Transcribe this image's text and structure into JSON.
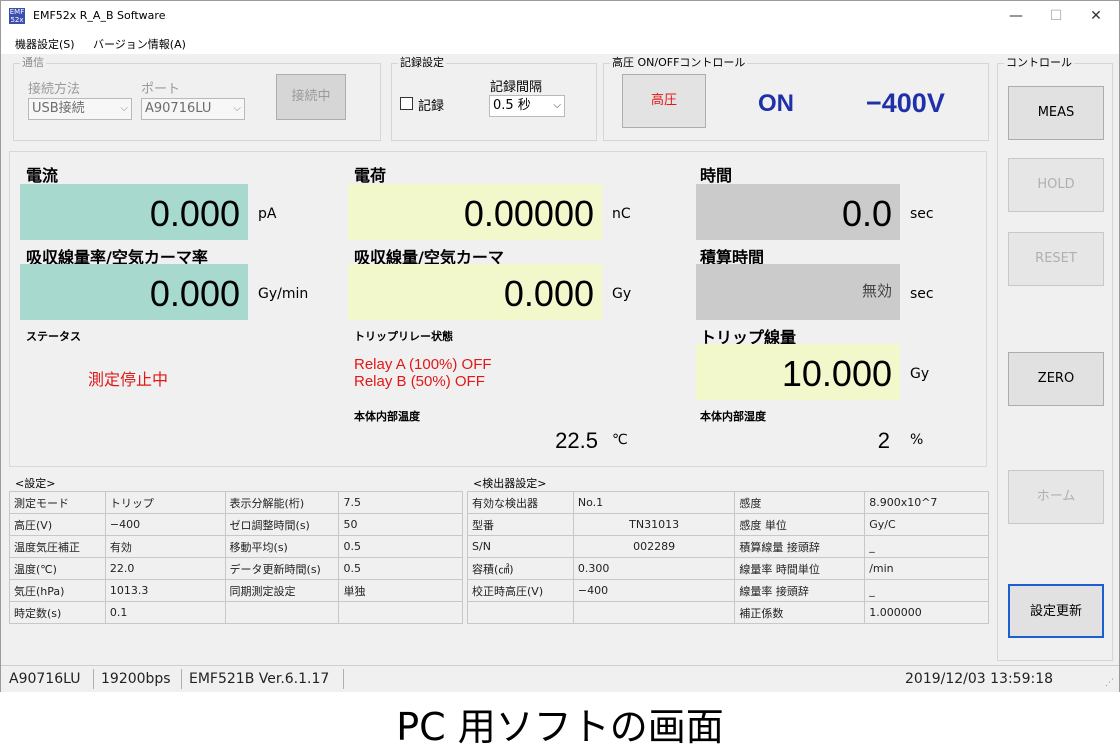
{
  "window": {
    "title": "EMF52x R_A_B Software",
    "icon_text": "EMF\n52x",
    "minimize": "—",
    "maximize": "☐",
    "close": "✕"
  },
  "menu": {
    "items": [
      "機器設定(S)",
      "バージョン情報(A)"
    ]
  },
  "comm": {
    "group_label": "通信",
    "method_label": "接続方法",
    "method_value": "USB接続",
    "port_label": "ポート",
    "port_value": "A90716LU",
    "connect_button": "接続中"
  },
  "record": {
    "group_label": "記録設定",
    "checkbox_label": "記録",
    "interval_label": "記録間隔",
    "interval_value": "0.5 秒"
  },
  "hv": {
    "group_label": "高圧 ON/OFFコントロール",
    "button": "高圧",
    "state": "ON",
    "voltage": "−400V"
  },
  "control": {
    "group_label": "コントロール",
    "meas": "MEAS",
    "hold": "HOLD",
    "reset": "RESET",
    "zero": "ZERO",
    "home": "ホーム",
    "update": "設定更新"
  },
  "display": {
    "current": {
      "label": "電流",
      "value": "0.000",
      "unit": "pA"
    },
    "charge": {
      "label": "電荷",
      "value": "0.00000",
      "unit": "nC"
    },
    "time": {
      "label": "時間",
      "value": "0.0",
      "unit": "sec"
    },
    "doserate": {
      "label": "吸収線量率/空気カーマ率",
      "value": "0.000",
      "unit": "Gy/min"
    },
    "dose": {
      "label": "吸収線量/空気カーマ",
      "value": "0.000",
      "unit": "Gy"
    },
    "integ_time": {
      "label": "積算時間",
      "value": "無効",
      "unit": "sec"
    },
    "status": {
      "label": "ステータス",
      "value": "測定停止中"
    },
    "relay": {
      "label": "トリップリレー状態",
      "line1": "Relay A (100%) OFF",
      "line2": "Relay B (50%) OFF"
    },
    "trip_dose": {
      "label": "トリップ線量",
      "value": "10.000",
      "unit": "Gy"
    },
    "temp": {
      "label": "本体内部温度",
      "value": "22.5",
      "unit": "℃"
    },
    "humidity": {
      "label": "本体内部湿度",
      "value": "2",
      "unit": "%"
    }
  },
  "settings": {
    "title": "<設定>",
    "rows": [
      [
        "測定モード",
        "トリップ",
        "表示分解能(桁)",
        "7.5"
      ],
      [
        "高圧(V)",
        "−400",
        "ゼロ調整時間(s)",
        "50"
      ],
      [
        "温度気圧補正",
        "有効",
        "移動平均(s)",
        "0.5"
      ],
      [
        "温度(℃)",
        "22.0",
        "データ更新時間(s)",
        "0.5"
      ],
      [
        "気圧(hPa)",
        "1013.3",
        "同期測定設定",
        "単独"
      ],
      [
        "時定数(s)",
        "0.1",
        "",
        ""
      ]
    ]
  },
  "detector": {
    "title": "<検出器設定>",
    "rows": [
      [
        "有効な検出器",
        "No.1",
        "感度",
        "8.900x10^7"
      ],
      [
        "型番",
        "TN31013",
        "感度 単位",
        "Gy/C"
      ],
      [
        "S/N",
        "002289",
        "積算線量 接頭辞",
        "_"
      ],
      [
        "容積(㎤)",
        "0.300",
        "線量率 時間単位",
        "/min"
      ],
      [
        "校正時高圧(V)",
        "−400",
        "線量率 接頭辞",
        "_"
      ],
      [
        "",
        "",
        "補正係数",
        "1.000000"
      ]
    ]
  },
  "statusbar": {
    "port": "A90716LU",
    "baud": "19200bps",
    "version": "EMF521B Ver.6.1.17",
    "datetime": "2019/12/03 13:59:18"
  },
  "caption": "PC 用ソフトの画面",
  "colors": {
    "teal": "#a8d9cf",
    "yellow": "#f2f7cc",
    "gray": "#cbcbcb",
    "blue": "#2030a8",
    "red": "#e01818"
  }
}
